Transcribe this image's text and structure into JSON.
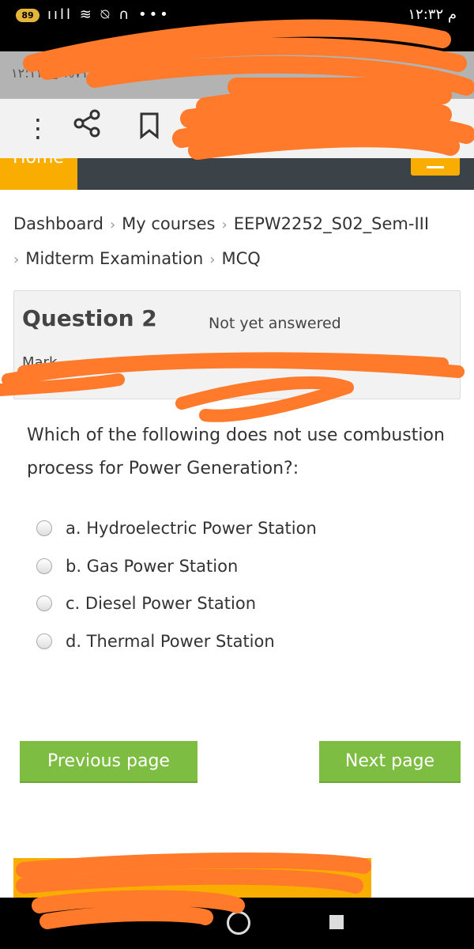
{
  "status_bar": {
    "battery": "89",
    "icons": "ııll ≋ ⍉ ∩ •••",
    "time": "۱۲:۳۲ م"
  },
  "url_bar": {
    "left_text": "۱۲:۱۱ ■ %۷۱"
  },
  "toolbar": {
    "icons": [
      "more-vert-icon",
      "share-icon",
      "bookmark-icon"
    ]
  },
  "nav": {
    "home_label": "Home"
  },
  "breadcrumb": [
    "Dashboard",
    "My courses",
    "EEPW2252_S02_Sem-III",
    "Midterm Examination",
    "MCQ"
  ],
  "question": {
    "title": "Question 2",
    "state": "Not yet answered",
    "marks_label": "Mark",
    "text": "Which of the following does not use combustion process for Power Generation?:",
    "options": [
      {
        "label": "a. Hydroelectric Power Station",
        "selected": false
      },
      {
        "label": "b. Gas Power Station",
        "selected": false
      },
      {
        "label": "c. Diesel Power Station",
        "selected": false
      },
      {
        "label": "d. Thermal Power Station",
        "selected": false
      }
    ]
  },
  "buttons": {
    "previous": "Previous page",
    "next": "Next page"
  },
  "colors": {
    "accent": "#f9ad00",
    "button": "#7cbd42",
    "nav": "#3b4349",
    "redaction": "#ff7a2a"
  }
}
